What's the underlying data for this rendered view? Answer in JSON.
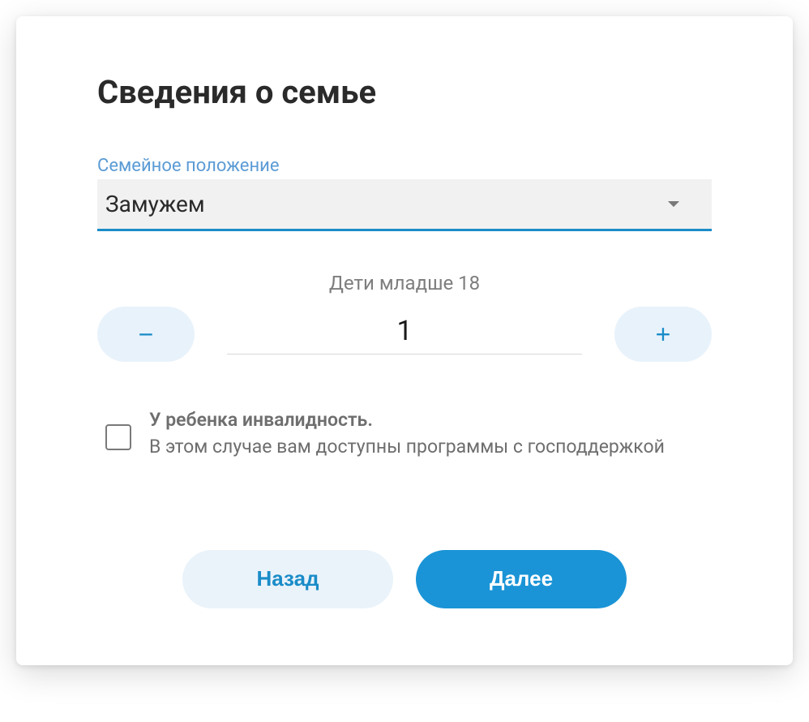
{
  "title": "Сведения о семье",
  "maritalStatus": {
    "label": "Семейное положение",
    "value": "Замужем"
  },
  "children": {
    "label": "Дети младше 18",
    "value": "1",
    "minusLabel": "−",
    "plusLabel": "+"
  },
  "disability": {
    "titleLine": "У ребенка инвалидность.",
    "subLine": "В этом случае вам доступны программы с господдержкой"
  },
  "nav": {
    "back": "Назад",
    "next": "Далее"
  }
}
